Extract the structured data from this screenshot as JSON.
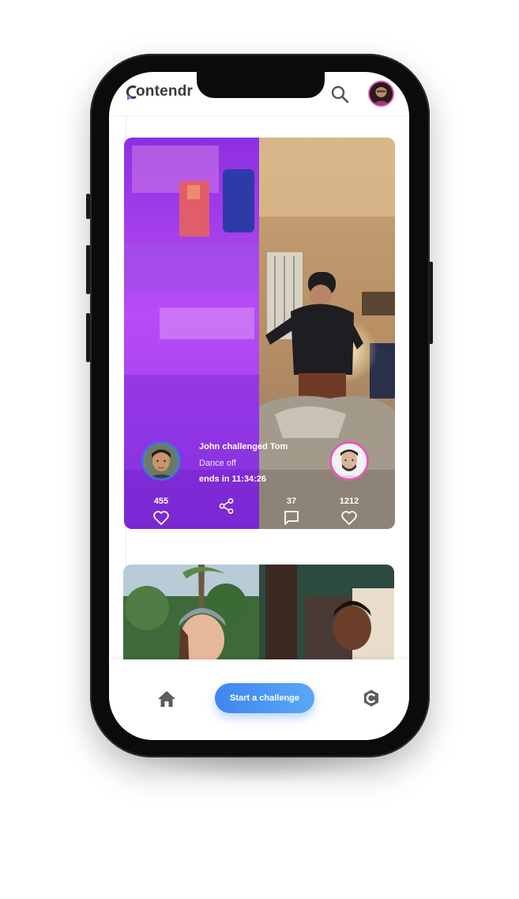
{
  "app": {
    "brand": "ontendr",
    "brand_initial": "C"
  },
  "header": {
    "search_icon": "search-icon",
    "avatar": "user-avatar"
  },
  "challenge_card": {
    "title": "John challenged Tom",
    "category": "Dance off",
    "countdown": "ends in 11:34:26",
    "likes_left": "455",
    "comments": "37",
    "likes_right": "1212"
  },
  "bottom_nav": {
    "cta_label": "Start a challenge",
    "home_icon": "home-icon",
    "brand_icon": "contendr-logo-icon"
  },
  "colors": {
    "accent_blue": "#3f86f0",
    "accent_pink": "#e35bb8",
    "video_left_tint": "#b548f5"
  }
}
